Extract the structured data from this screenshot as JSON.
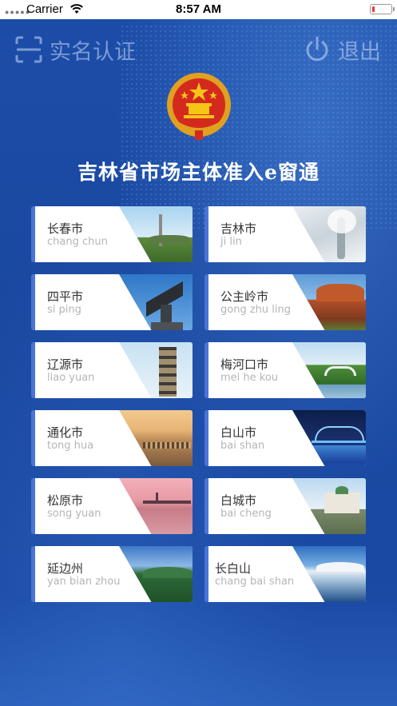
{
  "status_bar": {
    "carrier": "Carrier",
    "time": "8:57 AM"
  },
  "header": {
    "verify_label": "实名认证",
    "verify_icon": "scan-frame-icon",
    "logout_label": "退出",
    "logout_icon": "power-icon",
    "emblem_icon": "national-emblem-icon",
    "title": "吉林省市场主体准入e窗通"
  },
  "colors": {
    "background": "#1a4aa0",
    "card_accent": "#4a73d8",
    "card_bg": "#ffffff"
  },
  "cities": [
    {
      "name": "长春市",
      "pinyin": "chang chun"
    },
    {
      "name": "吉林市",
      "pinyin": "ji lin"
    },
    {
      "name": "四平市",
      "pinyin": "si ping"
    },
    {
      "name": "公主岭市",
      "pinyin": "gong zhu ling"
    },
    {
      "name": "辽源市",
      "pinyin": "liao yuan"
    },
    {
      "name": "梅河口市",
      "pinyin": "mei he kou"
    },
    {
      "name": "通化市",
      "pinyin": "tong hua"
    },
    {
      "name": "白山市",
      "pinyin": "bai shan"
    },
    {
      "name": "松原市",
      "pinyin": "song yuan"
    },
    {
      "name": "白城市",
      "pinyin": "bai cheng"
    },
    {
      "name": "延边州",
      "pinyin": "yan bian zhou"
    },
    {
      "name": "长白山",
      "pinyin": "chang bai shan"
    }
  ]
}
